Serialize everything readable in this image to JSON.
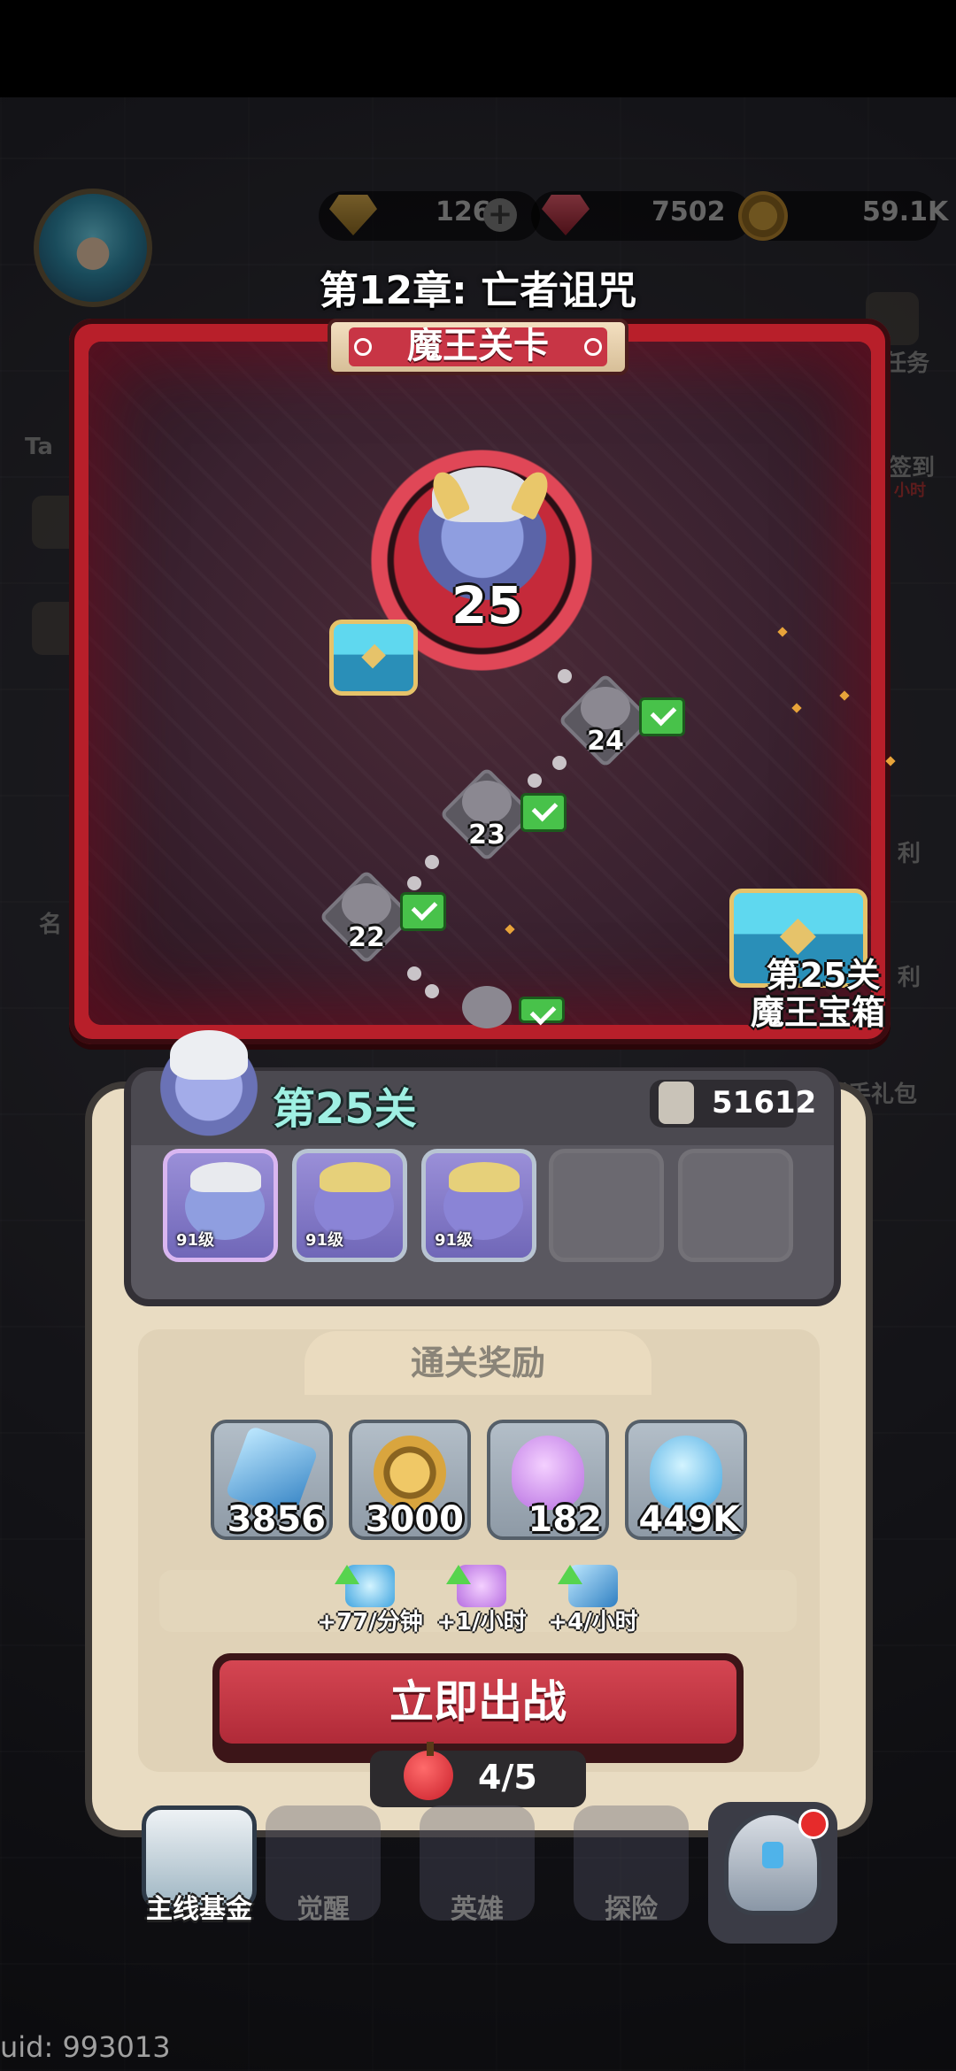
{
  "hud": {
    "gem1_value": "126",
    "gem2_value": "7502",
    "gold_value": "59.1K",
    "plus_glyph": "+"
  },
  "chapter": {
    "title": "第12章: 亡者诅咒",
    "banner": "魔王关卡"
  },
  "map": {
    "boss_level": "25",
    "nodes": [
      "24",
      "23",
      "22"
    ],
    "chest_label_line1": "第25关",
    "chest_label_line2": "魔王宝箱"
  },
  "side_labels": {
    "left_top": "Ta",
    "left_mid": "名",
    "right_1": "任务",
    "right_2": "签到",
    "right_2_sub": "小时",
    "right_3": "利",
    "right_4": "利",
    "right_5": "新手礼包"
  },
  "stage": {
    "name": "第25关",
    "power": "51612",
    "enemy_levels": [
      "91级",
      "91级",
      "91级"
    ]
  },
  "rewards": {
    "title": "通关奖励",
    "items": [
      {
        "icon": "blue-crystal-icon",
        "count": "3856"
      },
      {
        "icon": "gold-coin-icon",
        "count": "3000"
      },
      {
        "icon": "purple-potion-icon",
        "count": "182"
      },
      {
        "icon": "blue-potion-icon",
        "count": "449K"
      }
    ],
    "rates": [
      {
        "icon": "blue-potion-up-icon",
        "text": "+77/分钟"
      },
      {
        "icon": "purple-potion-up-icon",
        "text": "+1/小时"
      },
      {
        "icon": "crystal-up-icon",
        "text": "+4/小时"
      }
    ]
  },
  "action": {
    "fight_label": "立即出战",
    "stamina": "4/5"
  },
  "nav": {
    "fund": "主线基金",
    "awaken": "觉醒",
    "heroes": "英雄",
    "explore": "探险"
  },
  "footer": {
    "uid": "uid: 993013"
  },
  "colors": {
    "map_frame": "#b81f2a",
    "fight_button": "#c83545",
    "stage_name": "#9ff0e3",
    "panel_bg": "#e9dcc2"
  }
}
